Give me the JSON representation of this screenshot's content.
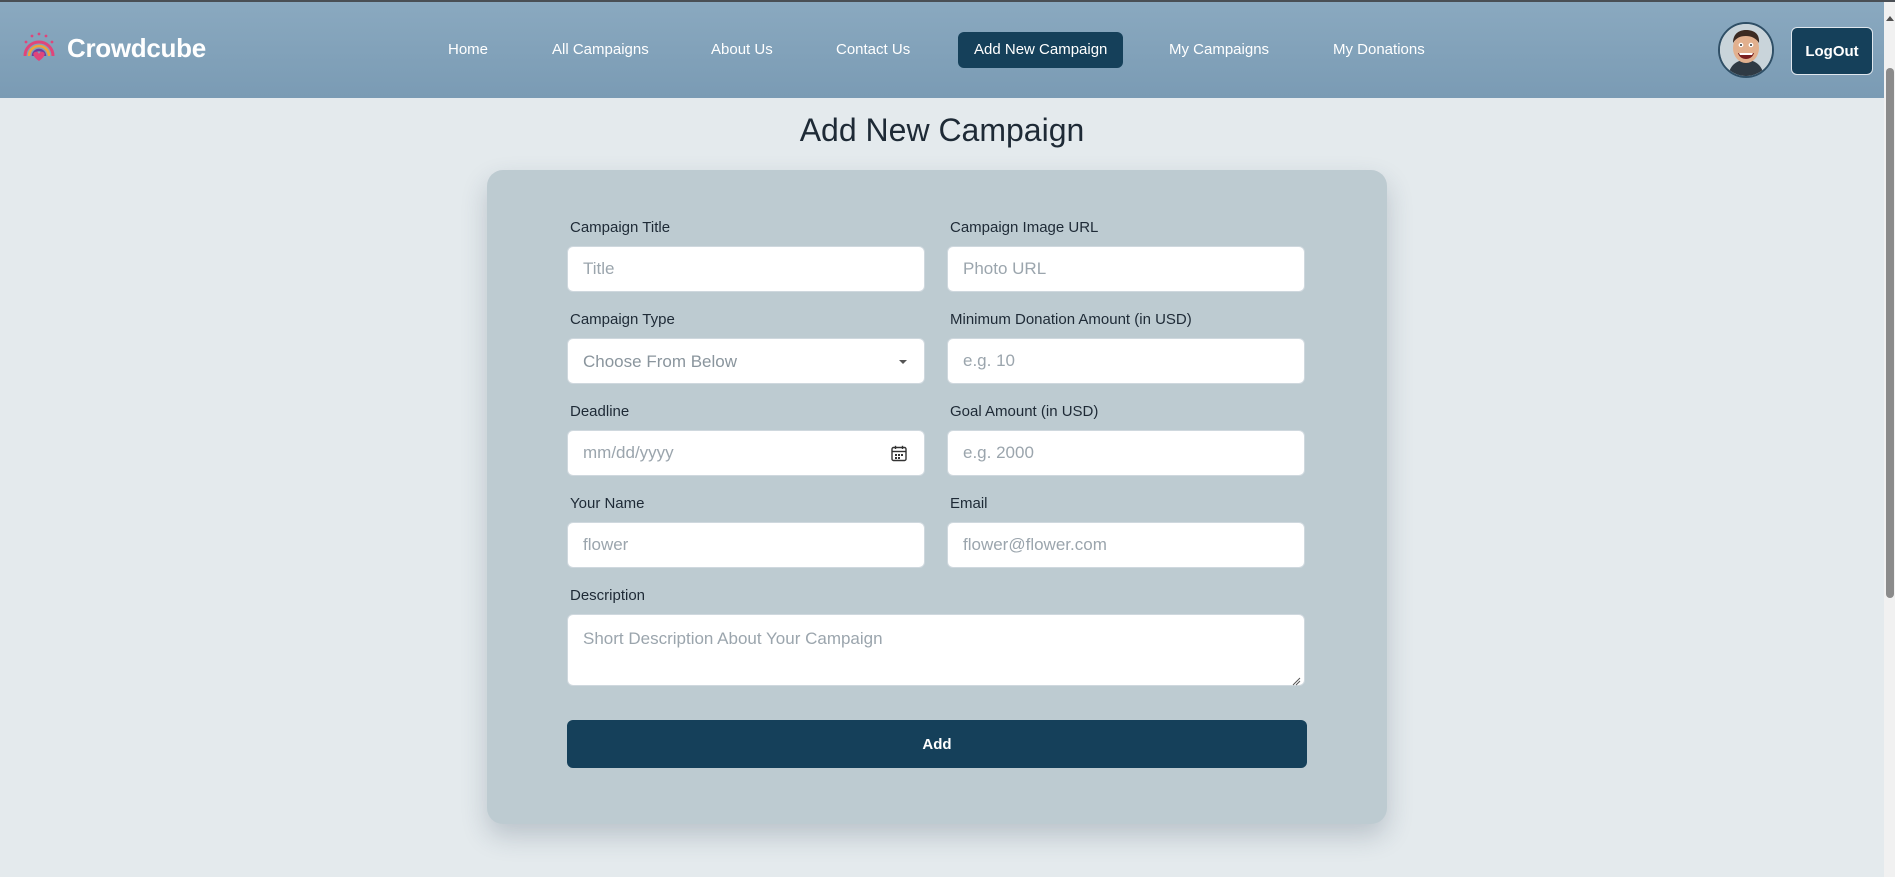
{
  "brand": {
    "name": "Crowdcube",
    "logo_icon": "rainbow-heart-logo"
  },
  "nav": {
    "links": [
      {
        "label": "Home",
        "active": false
      },
      {
        "label": "All Campaigns",
        "active": false
      },
      {
        "label": "About Us",
        "active": false
      },
      {
        "label": "Contact Us",
        "active": false
      },
      {
        "label": "Add New Campaign",
        "active": true
      },
      {
        "label": "My Campaigns",
        "active": false
      },
      {
        "label": "My Donations",
        "active": false
      }
    ],
    "avatar_icon": "user-avatar",
    "logout_label": "LogOut"
  },
  "page": {
    "title": "Add New Campaign"
  },
  "form": {
    "campaign_title": {
      "label": "Campaign Title",
      "placeholder": "Title",
      "value": ""
    },
    "image_url": {
      "label": "Campaign Image URL",
      "placeholder": "Photo URL",
      "value": ""
    },
    "campaign_type": {
      "label": "Campaign Type",
      "selected": "Choose From Below"
    },
    "min_donation": {
      "label": "Minimum Donation Amount (in USD)",
      "placeholder": "e.g. 10",
      "value": ""
    },
    "deadline": {
      "label": "Deadline",
      "placeholder": "mm/dd/yyyy",
      "value": ""
    },
    "goal_amount": {
      "label": "Goal Amount (in USD)",
      "placeholder": "e.g. 2000",
      "value": ""
    },
    "your_name": {
      "label": "Your Name",
      "placeholder": "flower",
      "value": ""
    },
    "email": {
      "label": "Email",
      "placeholder": "flower@flower.com",
      "value": ""
    },
    "description": {
      "label": "Description",
      "placeholder": "Short Description About Your Campaign",
      "value": ""
    },
    "submit_label": "Add"
  },
  "colors": {
    "navbar": "#7a9bb4",
    "accent": "#15405a",
    "page_background": "#e4eaed",
    "card_background": "#bdcbd1"
  }
}
